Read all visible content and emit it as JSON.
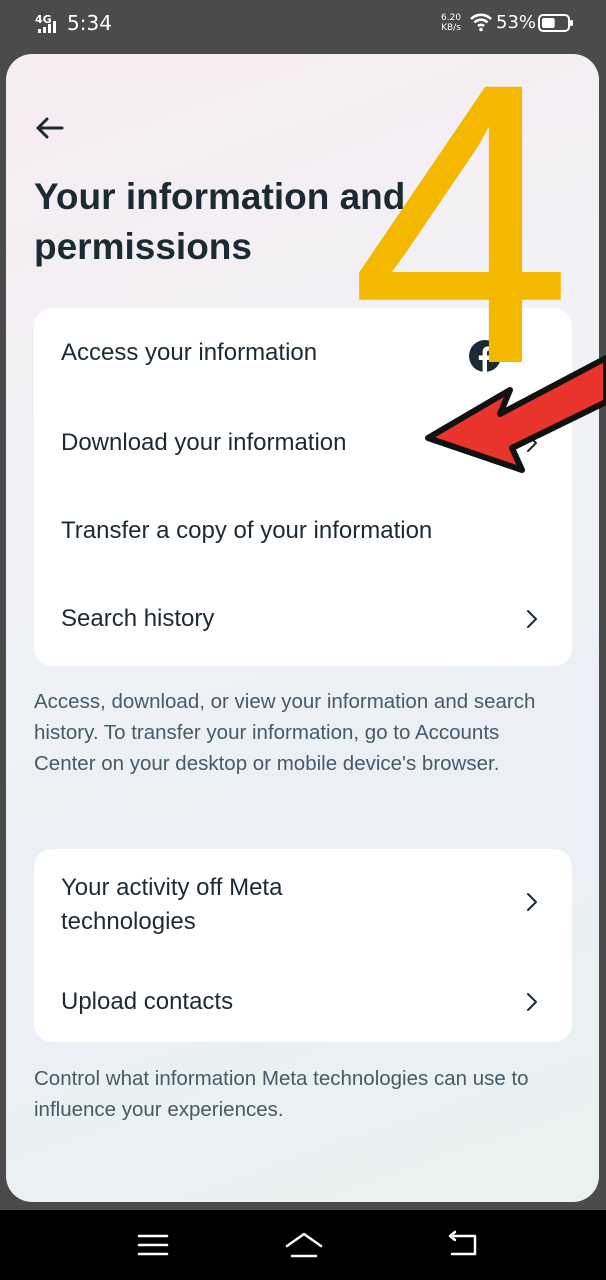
{
  "status_bar": {
    "network": "4G",
    "time": "5:34",
    "speed_value": "6.20",
    "speed_unit": "KB/s",
    "battery_percent": "53%",
    "battery_level": 0.53
  },
  "header": {
    "back_icon": "arrow-left-icon",
    "title": "Your information and permissions"
  },
  "section_1": {
    "items": [
      {
        "label": "Access your information",
        "icon": "facebook-icon"
      },
      {
        "label": "Download your information",
        "icon": "chevron-right-icon"
      },
      {
        "label": "Transfer a copy of your information"
      },
      {
        "label": "Search history",
        "icon": "chevron-right-icon"
      }
    ],
    "helper_text": "Access, download, or view your information and search history. To transfer your information, go to Accounts Center on your desktop or mobile device's browser."
  },
  "section_2": {
    "items": [
      {
        "label_line1": "Your activity off Meta",
        "label_line2": "technologies",
        "icon": "chevron-right-icon"
      },
      {
        "label": "Upload contacts",
        "icon": "chevron-right-icon"
      }
    ],
    "helper_text": "Control what information Meta technologies can use to influence your experiences."
  },
  "annotation": {
    "number": "4",
    "number_color": "#f5b800",
    "arrow_color": "#e8342b",
    "arrow_icon": "red-arrow-pointer"
  },
  "nav_bar": {
    "menu_icon": "hamburger-menu-icon",
    "home_icon": "home-icon",
    "back_icon": "return-back-icon"
  }
}
